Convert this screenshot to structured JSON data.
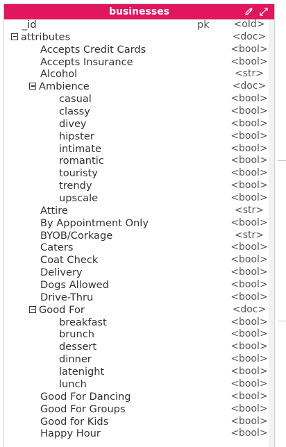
{
  "header": {
    "title": "businesses",
    "title_bg": "#e0165f",
    "icons": [
      "edit-icon",
      "expand-icon"
    ]
  },
  "rows": [
    {
      "name": "_id",
      "pk": "pk",
      "type": "<oId>",
      "level": 0,
      "toggle": false
    },
    {
      "name": "attributes",
      "pk": "",
      "type": "<doc>",
      "level": 0,
      "toggle": true
    },
    {
      "name": "Accepts Credit Cards",
      "pk": "",
      "type": "<bool>",
      "level": 1,
      "toggle": false
    },
    {
      "name": "Accepts Insurance",
      "pk": "",
      "type": "<bool>",
      "level": 1,
      "toggle": false
    },
    {
      "name": "Alcohol",
      "pk": "",
      "type": "<str>",
      "level": 1,
      "toggle": false
    },
    {
      "name": "Ambience",
      "pk": "",
      "type": "<doc>",
      "level": 1,
      "toggle": true
    },
    {
      "name": "casual",
      "pk": "",
      "type": "<bool>",
      "level": 2,
      "toggle": false
    },
    {
      "name": "classy",
      "pk": "",
      "type": "<bool>",
      "level": 2,
      "toggle": false
    },
    {
      "name": "divey",
      "pk": "",
      "type": "<bool>",
      "level": 2,
      "toggle": false
    },
    {
      "name": "hipster",
      "pk": "",
      "type": "<bool>",
      "level": 2,
      "toggle": false
    },
    {
      "name": "intimate",
      "pk": "",
      "type": "<bool>",
      "level": 2,
      "toggle": false
    },
    {
      "name": "romantic",
      "pk": "",
      "type": "<bool>",
      "level": 2,
      "toggle": false
    },
    {
      "name": "touristy",
      "pk": "",
      "type": "<bool>",
      "level": 2,
      "toggle": false
    },
    {
      "name": "trendy",
      "pk": "",
      "type": "<bool>",
      "level": 2,
      "toggle": false
    },
    {
      "name": "upscale",
      "pk": "",
      "type": "<bool>",
      "level": 2,
      "toggle": false
    },
    {
      "name": "Attire",
      "pk": "",
      "type": "<str>",
      "level": 1,
      "toggle": false
    },
    {
      "name": "By Appointment Only",
      "pk": "",
      "type": "<bool>",
      "level": 1,
      "toggle": false
    },
    {
      "name": "BYOB/Corkage",
      "pk": "",
      "type": "<str>",
      "level": 1,
      "toggle": false
    },
    {
      "name": "Caters",
      "pk": "",
      "type": "<bool>",
      "level": 1,
      "toggle": false
    },
    {
      "name": "Coat Check",
      "pk": "",
      "type": "<bool>",
      "level": 1,
      "toggle": false
    },
    {
      "name": "Delivery",
      "pk": "",
      "type": "<bool>",
      "level": 1,
      "toggle": false
    },
    {
      "name": "Dogs Allowed",
      "pk": "",
      "type": "<bool>",
      "level": 1,
      "toggle": false
    },
    {
      "name": "Drive-Thru",
      "pk": "",
      "type": "<bool>",
      "level": 1,
      "toggle": false
    },
    {
      "name": "Good For",
      "pk": "",
      "type": "<doc>",
      "level": 1,
      "toggle": true
    },
    {
      "name": "breakfast",
      "pk": "",
      "type": "<bool>",
      "level": 2,
      "toggle": false
    },
    {
      "name": "brunch",
      "pk": "",
      "type": "<bool>",
      "level": 2,
      "toggle": false
    },
    {
      "name": "dessert",
      "pk": "",
      "type": "<bool>",
      "level": 2,
      "toggle": false
    },
    {
      "name": "dinner",
      "pk": "",
      "type": "<bool>",
      "level": 2,
      "toggle": false
    },
    {
      "name": "latenight",
      "pk": "",
      "type": "<bool>",
      "level": 2,
      "toggle": false
    },
    {
      "name": "lunch",
      "pk": "",
      "type": "<bool>",
      "level": 2,
      "toggle": false
    },
    {
      "name": "Good For Dancing",
      "pk": "",
      "type": "<bool>",
      "level": 1,
      "toggle": false
    },
    {
      "name": "Good For Groups",
      "pk": "",
      "type": "<bool>",
      "level": 1,
      "toggle": false
    },
    {
      "name": "Good for Kids",
      "pk": "",
      "type": "<bool>",
      "level": 1,
      "toggle": false
    },
    {
      "name": "Happy Hour",
      "pk": "",
      "type": "<bool>",
      "level": 1,
      "toggle": false
    }
  ]
}
